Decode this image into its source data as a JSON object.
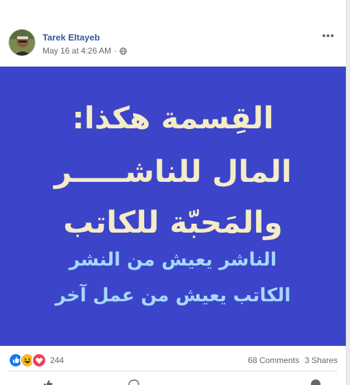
{
  "post": {
    "author": "Tarek Eltayeb",
    "timestamp": "May 16 at 4:26 AM",
    "separator": "·",
    "privacy_icon": "globe-icon",
    "more_icon": "ellipsis-icon"
  },
  "image": {
    "background_color": "#3c45c9",
    "lines": [
      "القِسمة هكذا:",
      "المال للناشـــــر",
      "والمَحبّة للكاتب",
      "الناشر يعيش من النشر",
      "الكاتب يعيش من عمل آخر"
    ]
  },
  "footer": {
    "reaction_icons": [
      "like-icon",
      "haha-icon",
      "love-icon"
    ],
    "reaction_count": "244",
    "comments": "68 Comments",
    "shares": "3 Shares"
  }
}
